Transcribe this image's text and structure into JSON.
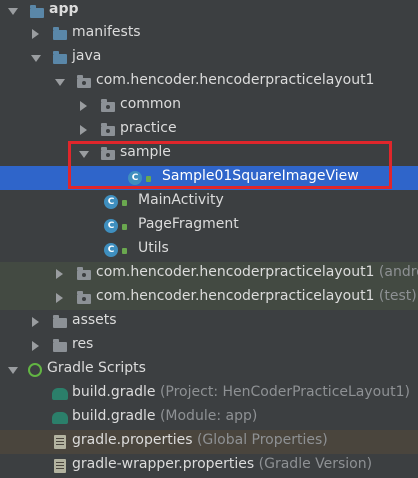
{
  "tree": {
    "app": "app",
    "manifests": "manifests",
    "java": "java",
    "package_main": "com.hencoder.hencoderpracticelayout1",
    "common": "common",
    "practice": "practice",
    "sample": "sample",
    "sample_class": "Sample01SquareImageView",
    "main_activity": "MainActivity",
    "page_fragment": "PageFragment",
    "utils": "Utils",
    "package_android_test": "com.hencoder.hencoderpracticelayout1",
    "package_android_test_hint": "(andro",
    "package_test": "com.hencoder.hencoderpracticelayout1",
    "package_test_hint": "(test)",
    "assets": "assets",
    "res": "res",
    "gradle_scripts": "Gradle Scripts",
    "build_gradle_project": "build.gradle",
    "build_gradle_project_hint": "(Project: HenCoderPracticeLayout1)",
    "build_gradle_module": "build.gradle",
    "build_gradle_module_hint": "(Module: app)",
    "gradle_properties": "gradle.properties",
    "gradle_properties_hint": "(Global Properties)",
    "gradle_wrapper": "gradle-wrapper.properties",
    "gradle_wrapper_hint": "(Gradle Version)"
  },
  "icons": {
    "class_glyph": "C"
  },
  "colors": {
    "background": "#3c3f41",
    "selection": "#2f65ca",
    "highlight_border": "#e0262b",
    "folder_blue": "#5a87a8",
    "class_icon": "#3f8fbf"
  }
}
